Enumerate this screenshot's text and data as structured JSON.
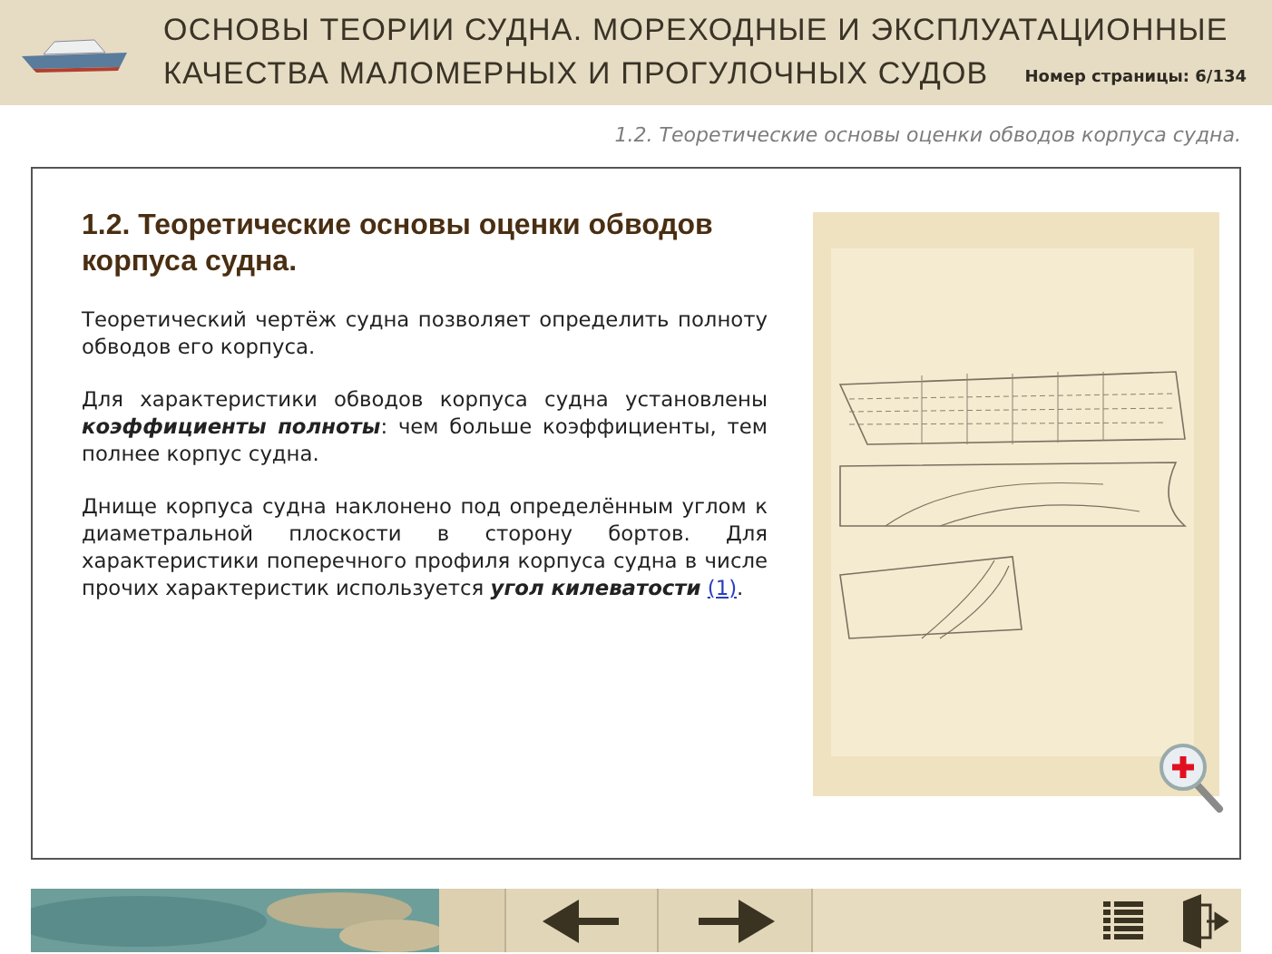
{
  "header": {
    "title_lines": [
      "ОСНОВЫ ТЕОРИИ СУДНА. МОРЕХОДНЫЕ И ЭКСПЛУАТАЦИОННЫЕ",
      "КАЧЕСТВА МАЛОМЕРНЫХ И ПРОГУЛОЧНЫХ СУДОВ"
    ],
    "page_number": "Номер страницы: 6/134"
  },
  "breadcrumb": "1.2. Теоретические основы оценки обводов корпуса судна.",
  "content": {
    "heading": "1.2. Теоретические основы оценки обводов корпуса судна.",
    "paragraphs": [
      {
        "text": "Теоретический чертёж судна позволяет определить полноту обводов его корпуса."
      },
      {
        "text": "Для характеристики обводов корпуса судна установлены **коэффициенты полноты**: чем больше коэффициенты, тем полнее корпус судна."
      },
      {
        "text": "Днище корпуса судна наклонено под определённым углом к диаметральной плоскости в сторону бортов. Для характеристики поперечного профиля корпуса судна в числе прочих характеристик используется **угол килеватости**",
        "link": "(1)",
        "tail": "."
      }
    ]
  }
}
